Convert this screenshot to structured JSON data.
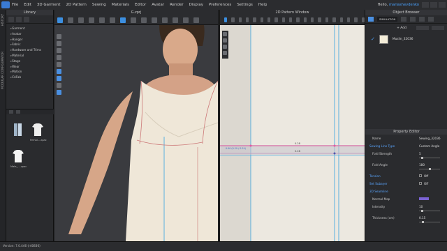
{
  "menubar": {
    "items": [
      "File",
      "Edit",
      "3D Garment",
      "2D Pattern",
      "Sewing",
      "Materials",
      "Editor",
      "Avatar",
      "Render",
      "Display",
      "Preferences",
      "Settings",
      "Help"
    ],
    "user_prefix": "Hello, ",
    "user_name": "mariashevdenko"
  },
  "left_tabs": {
    "history": "HISTORY",
    "modular": "MODULAR CONFIGURATOR"
  },
  "library": {
    "title": "Library",
    "items": [
      "Garment",
      "Avatar",
      "Hanger",
      "Fabric",
      "Hardware and Trims",
      "Material",
      "Stage",
      "Wear",
      "Motion",
      "CAFab"
    ],
    "thumbs": [
      {
        "label": ""
      },
      {
        "label": "Femal....zpac"
      },
      {
        "label": "Male_....zpac"
      }
    ]
  },
  "viewport3d": {
    "title": "G.zprj"
  },
  "pattern2d": {
    "title": "2D Pattern Window",
    "measure_labels": [
      "0.28",
      "0.28",
      "0.00 (0.29 / 0.29)"
    ]
  },
  "object_browser": {
    "title": "Object Browser",
    "simulation_label": "SIMULATION",
    "add_label": "+ Add",
    "fabric_name": "Muslin_32036"
  },
  "property_editor": {
    "title": "Property Editor",
    "rows": [
      {
        "key": "Name",
        "value": "Sewing_32036"
      },
      {
        "key": "Sewing Line Type",
        "value": "Custom Angle"
      },
      {
        "key": "Fold Strength",
        "value": "5"
      },
      {
        "key": "Fold Angle",
        "value": "180"
      },
      {
        "key": "Tension",
        "value": "Off"
      },
      {
        "key": "Set Subayer",
        "value": "Off"
      },
      {
        "key": "3D Seamline",
        "value": ""
      },
      {
        "key": "Normal Map",
        "value": ""
      },
      {
        "key": "Intensity",
        "value": "10"
      },
      {
        "key": "Thickness (cm)",
        "value": "0.15"
      }
    ],
    "fold_strength_fraction": 0.1,
    "fold_angle_fraction": 0.5,
    "intensity_fraction": 0.1,
    "thickness_fraction": 0.15
  },
  "statusbar": {
    "text": "Version: 7.0.446 (r40836)"
  },
  "colors": {
    "accent": "#4a90e2",
    "seam_pink": "#e05aa0",
    "seam_blue": "#5ab0e0",
    "fabric": "#f0e8d6",
    "normal_map": "#7b63d4"
  }
}
